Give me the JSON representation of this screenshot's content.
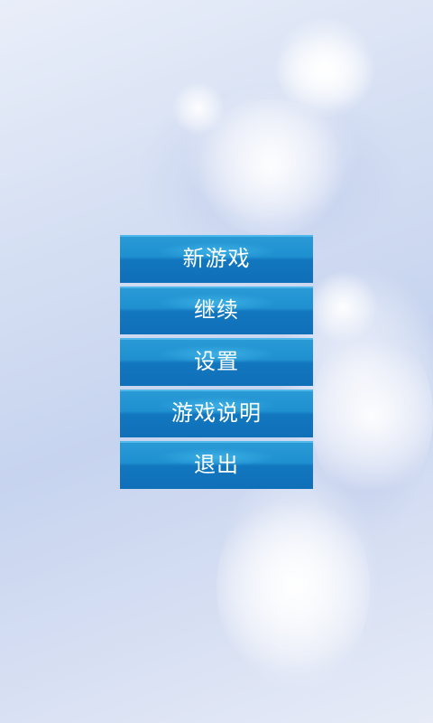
{
  "menu": {
    "items": [
      {
        "label": "新游戏"
      },
      {
        "label": "继续"
      },
      {
        "label": "设置"
      },
      {
        "label": "游戏说明"
      },
      {
        "label": "退出"
      }
    ]
  },
  "colors": {
    "button_top": "#2a9bd6",
    "button_bottom": "#0f6fb8",
    "background": "#d5dff3"
  }
}
